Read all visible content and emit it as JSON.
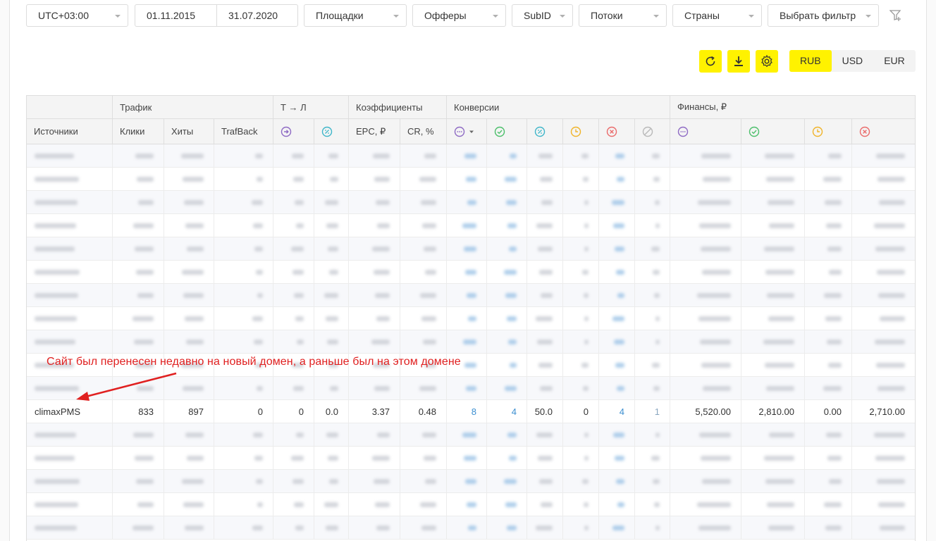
{
  "filters": {
    "timezone": "UTC+03:00",
    "date_from": "01.11.2015",
    "date_to": "31.07.2020",
    "platforms": "Площадки",
    "offers": "Офферы",
    "subid": "SubID",
    "flows": "Потоки",
    "countries": "Страны",
    "choose_filter": "Выбрать фильтр"
  },
  "currency": {
    "options": [
      "RUB",
      "USD",
      "EUR"
    ],
    "selected": "RUB"
  },
  "colors": {
    "accent": "#fff200",
    "link": "#3c8fd1",
    "annotation": "#e02020"
  },
  "table": {
    "group_headers": {
      "traffic": "Трафик",
      "t_to_l": "Т → Л",
      "coefficients": "Коэффициенты",
      "conversions": "Конверсии",
      "finance": "Финансы, ₽"
    },
    "column_headers": {
      "sources": "Источники",
      "clicks": "Клики",
      "hits": "Хиты",
      "trafback": "TrafBack",
      "epc": "EPC, ₽",
      "cr": "CR, %"
    },
    "visible_row": {
      "source": "climaxPMS",
      "clicks": "833",
      "hits": "897",
      "trafback": "0",
      "t_to_l_1": "0",
      "t_to_l_2": "0.0",
      "epc": "3.37",
      "cr": "0.48",
      "conv_total": "8",
      "conv_approved": "4",
      "conv_percent": "50.0",
      "conv_pending": "0",
      "conv_rejected": "4",
      "conv_trash": "1",
      "fin_total": "5,520.00",
      "fin_approved": "2,810.00",
      "fin_pending": "0.00",
      "fin_rejected": "2,710.00"
    }
  },
  "annotation": {
    "text": "Сайт был перенесен недавно на новый домен, а раньше был на этом домене"
  }
}
